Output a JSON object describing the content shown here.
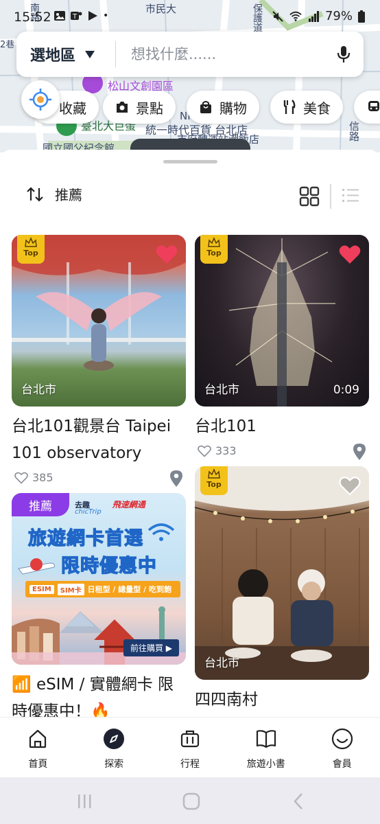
{
  "status_bar": {
    "time": "15:52",
    "battery": "79%"
  },
  "map": {
    "labels": [
      "市民大",
      "松山文創園區",
      "臺北大巨蛋",
      "統一時代百貨 台北店",
      "市府轉運站潮飯店",
      "國立國父紀念館",
      "NF",
      "信路",
      "2巷",
      "南路",
      "保護道"
    ]
  },
  "search": {
    "region_label": "選地區",
    "placeholder": "想找什麼......"
  },
  "categories": [
    {
      "label": "收藏",
      "icon": "bookmark-icon"
    },
    {
      "label": "景點",
      "icon": "camera-icon"
    },
    {
      "label": "購物",
      "icon": "shopping-bag-icon"
    },
    {
      "label": "美食",
      "icon": "fork-knife-icon"
    },
    {
      "label": "",
      "icon": "train-icon"
    }
  ],
  "sort": {
    "label": "推薦"
  },
  "cards": [
    {
      "title": "台北101觀景台 Taipei 101 observatory",
      "city": "台北市",
      "likes": "385",
      "badge": "Top",
      "favorited": true
    },
    {
      "title": "台北101",
      "city": "台北市",
      "duration": "0:09",
      "likes": "333",
      "badge": "Top",
      "favorited": true
    },
    {
      "title": "📶 eSIM / 實體網卡 限時優惠中！🔥",
      "promo_tag": "推薦",
      "ad": {
        "brand1": "去趣",
        "brand1_sub": "chicTrip",
        "brand2": "飛速網通",
        "headline1": "旅遊網卡首選",
        "headline2": "限時優惠中",
        "chips": [
          "ESIM",
          "SIM卡",
          "日租型 / 總量型 / 吃到飽"
        ],
        "cta": "前往購買 ▶"
      }
    },
    {
      "title": "四四南村",
      "city": "台北市",
      "badge": "Top",
      "favorited": false
    }
  ],
  "bottom_nav": [
    {
      "label": "首頁",
      "icon": "home-icon"
    },
    {
      "label": "探索",
      "icon": "compass-icon",
      "active": true
    },
    {
      "label": "行程",
      "icon": "suitcase-icon"
    },
    {
      "label": "旅遊小書",
      "icon": "book-icon"
    },
    {
      "label": "會員",
      "icon": "smile-icon"
    }
  ],
  "colors": {
    "top_badge": "#f2c21b",
    "heart_active": "#ef3e5c",
    "promo_purple": "#8b3ce6",
    "locate_blue": "#3d8bf0"
  }
}
